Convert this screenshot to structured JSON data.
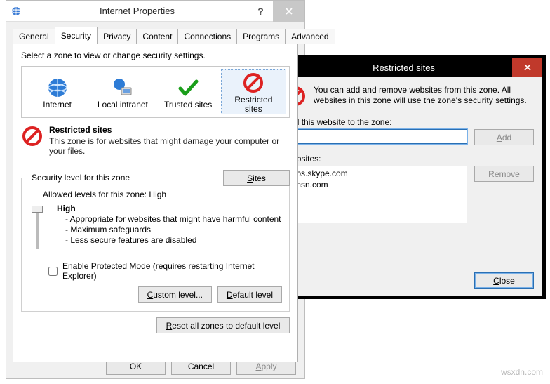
{
  "ip": {
    "title": "Internet Properties",
    "tabs": [
      "General",
      "Security",
      "Privacy",
      "Content",
      "Connections",
      "Programs",
      "Advanced"
    ],
    "active_tab": 1,
    "zone_prompt": "Select a zone to view or change security settings.",
    "zones": [
      {
        "label": "Internet",
        "icon": "globe"
      },
      {
        "label": "Local intranet",
        "icon": "intranet"
      },
      {
        "label": "Trusted sites",
        "icon": "check"
      },
      {
        "label": "Restricted\nsites",
        "icon": "restricted",
        "selected": true
      }
    ],
    "detail": {
      "title": "Restricted sites",
      "desc": "This zone is for websites that might damage your computer or your files."
    },
    "sites_btn": "Sites",
    "sec_legend": "Security level for this zone",
    "allowed": "Allowed levels for this zone: High",
    "sec_lines": {
      "high": "High",
      "l1": "- Appropriate for websites that might have harmful content",
      "l2": "- Maximum safeguards",
      "l3": "- Less secure features are disabled"
    },
    "checkbox": "Enable Protected Mode (requires restarting Internet Explorer)",
    "checkbox_checked": false,
    "custom_btn": "Custom level...",
    "default_btn": "Default level",
    "reset_btn": "Reset all zones to default level",
    "ok": "OK",
    "cancel": "Cancel",
    "apply": "Apply"
  },
  "rs": {
    "title": "Restricted sites",
    "intro": "You can add and remove websites from this zone. All websites in this zone will use the zone's security settings.",
    "add_label": "Add this website to the zone:",
    "add_value": "",
    "add_btn": "Add",
    "list_label": "Websites:",
    "list": [
      "apps.skype.com",
      "g.msn.com"
    ],
    "remove_btn": "Remove",
    "close_btn": "Close"
  },
  "watermark": "wsxdn.com"
}
